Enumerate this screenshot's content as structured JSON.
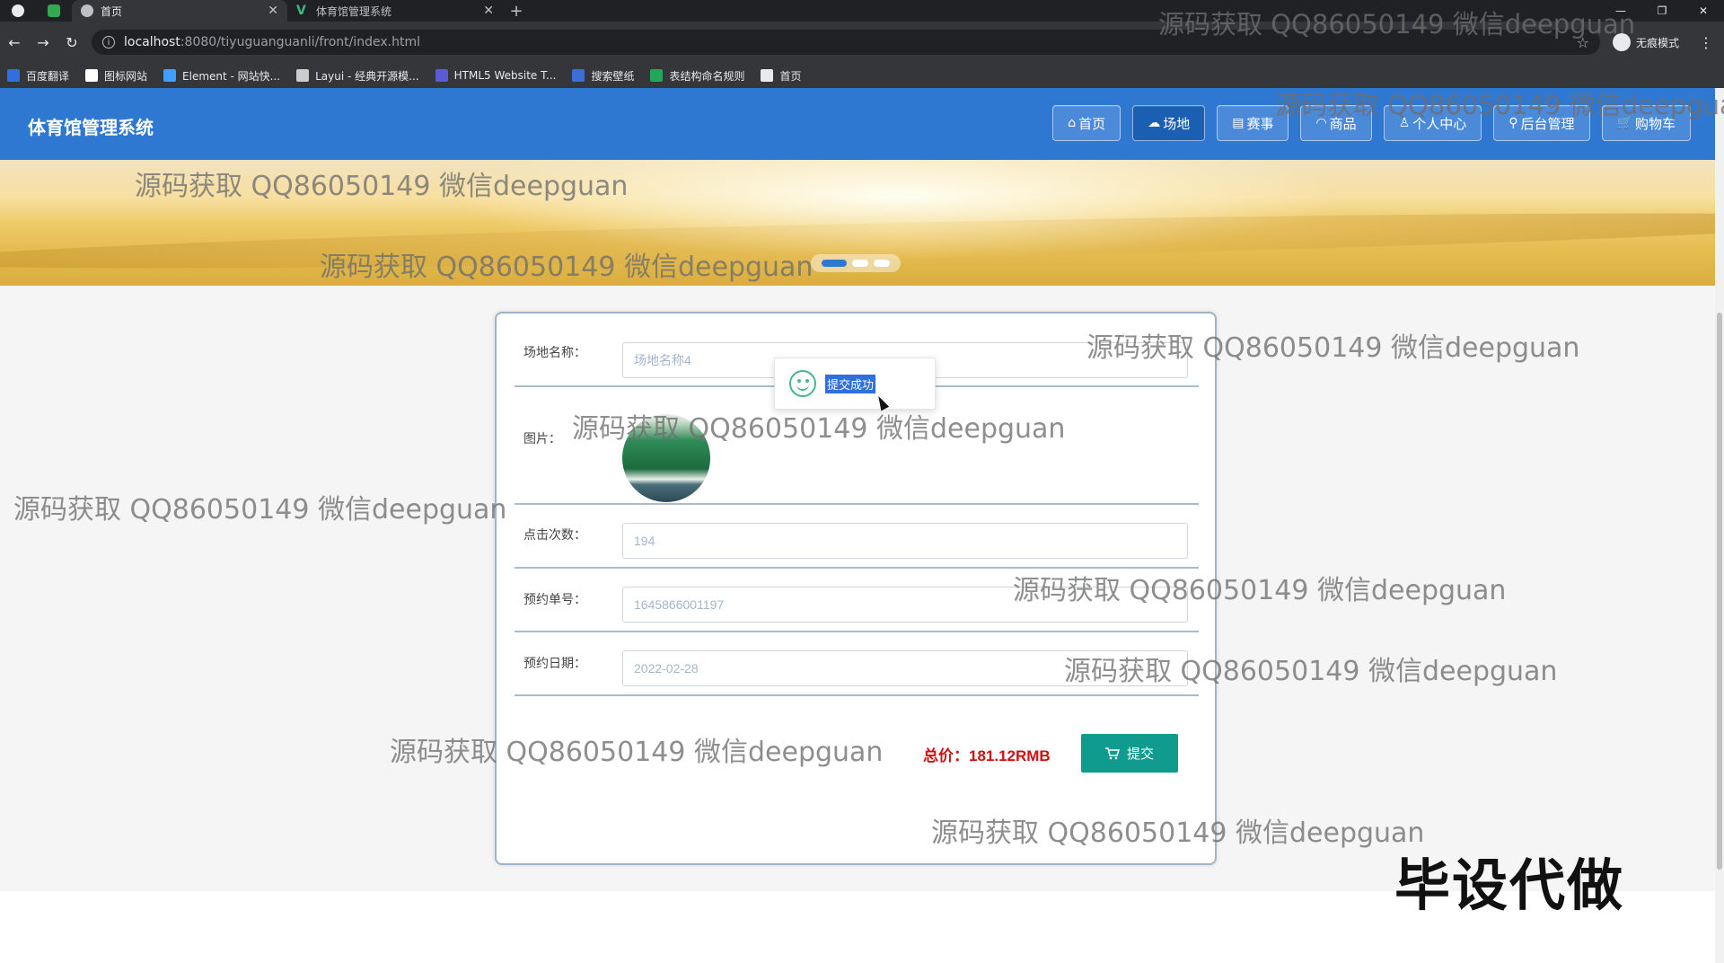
{
  "browser": {
    "tabs": [
      {
        "title": "首页",
        "active": true
      },
      {
        "title": "体育馆管理系统",
        "active": false
      }
    ],
    "new_tab": "+",
    "url_host": "localhost",
    "url_path": ":8080/tiyuguanguanli/front/index.html",
    "incognito_label": "无痕模式",
    "bookmarks": [
      {
        "label": "百度翻译",
        "color": "#2f6fe0"
      },
      {
        "label": "图标网站",
        "color": "#ffffff"
      },
      {
        "label": "Element - 网站快...",
        "color": "#409eff"
      },
      {
        "label": "Layui - 经典开源模...",
        "color": "#cccccc"
      },
      {
        "label": "HTML5 Website T...",
        "color": "#5b5bd6"
      },
      {
        "label": "搜索壁纸",
        "color": "#3b6fd6"
      },
      {
        "label": "表结构命名规则",
        "color": "#23a55a"
      },
      {
        "label": "首页",
        "color": "#e8eaed"
      }
    ]
  },
  "header": {
    "site_title": "体育馆管理系统",
    "nav": [
      {
        "label": "首页",
        "icon": "⌂",
        "active": false
      },
      {
        "label": "场地",
        "icon": "☁",
        "active": true
      },
      {
        "label": "赛事",
        "icon": "▤",
        "active": false
      },
      {
        "label": "商品",
        "icon": "◠",
        "active": false
      },
      {
        "label": "个人中心",
        "icon": "♙",
        "active": false
      },
      {
        "label": "后台管理",
        "icon": "⚲",
        "active": false
      },
      {
        "label": "购物车",
        "icon": "🛒",
        "active": false
      }
    ]
  },
  "banner": {
    "slide_count": 3,
    "active_slide": 1
  },
  "form": {
    "venue_name_label": "场地名称：",
    "venue_name_value": "场地名称4",
    "image_label": "图片：",
    "clicks_label": "点击次数：",
    "clicks_value": "194",
    "order_no_label": "预约单号：",
    "order_no_value": "1645866001197",
    "date_label": "预约日期：",
    "date_value": "2022-02-28",
    "total_text": "总价：181.12RMB",
    "submit_label": "提交"
  },
  "toast": {
    "message": "提交成功"
  },
  "watermark_text": "源码获取 QQ86050149 微信deepguan",
  "stamp_text": "毕设代做"
}
